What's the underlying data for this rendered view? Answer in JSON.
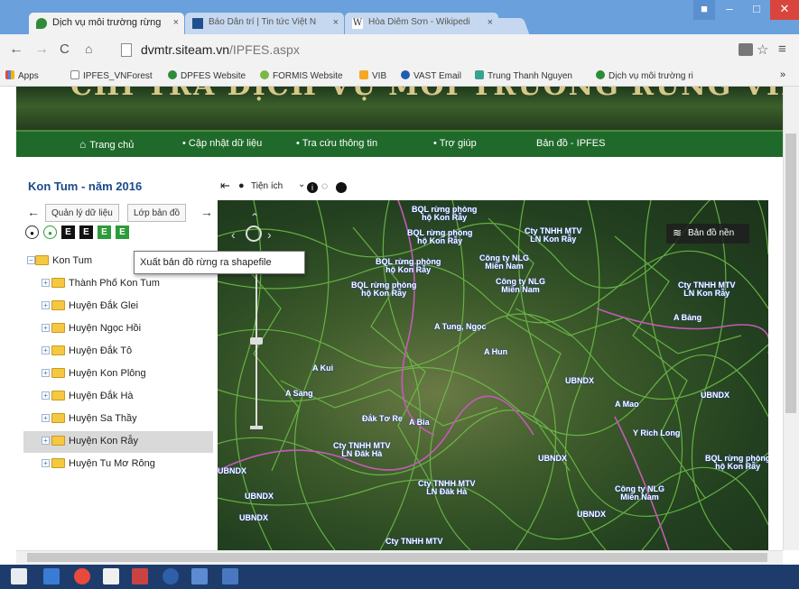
{
  "browser": {
    "tabs": [
      {
        "title": "Dịch vụ môi trường rừng",
        "close": "×"
      },
      {
        "title": "Báo Dân trí | Tin tức Việt N",
        "close": "×"
      },
      {
        "title": "Hòa Diêm Sơn - Wikipedi",
        "close": "×"
      }
    ],
    "window_controls": {
      "minimize": "–",
      "maximize": "□",
      "close": "✕"
    },
    "url_domain": "dvmtr.siteam.vn",
    "url_path": "/IPFES.aspx",
    "bookmarks": [
      "Apps",
      "IPFES_VNForest",
      "DPFES Website",
      "FORMIS Website",
      "VIB",
      "VAST Email",
      "Trung Thanh Nguyen",
      "Dịch vụ môi trường ri"
    ],
    "bookmarks_more": "»"
  },
  "site": {
    "banner_text": "CHI TRẢ DỊCH VỤ MÔI TRƯỜNG RỪNG VIỆT NAM",
    "nav": [
      "Trang chủ",
      "• Cập nhật dữ liệu",
      "• Tra cứu thông tin",
      "• Trợ giúp",
      "Bản đồ - IPFES"
    ]
  },
  "left_panel": {
    "title": "Kon Tum - năm 2016",
    "tabs": [
      "Quản lý dữ liệu",
      "Lớp bản đồ"
    ],
    "tree": {
      "root": "Kon Tum",
      "children": [
        "Thành Phố Kon Tum",
        "Huyện Đắk Glei",
        "Huyện Ngọc Hồi",
        "Huyện Đắk Tô",
        "Huyện Kon Plông",
        "Huyện Đắk Hà",
        "Huyện Sa Thầy",
        "Huyện Kon Rẫy",
        "Huyện Tu Mơ Rông"
      ],
      "selected": "Huyện Kon Rẫy"
    },
    "tooltip": "Xuất bản đồ rừng ra shapefile"
  },
  "map": {
    "toolbar_label": "Tiện ích",
    "basemap_button": "Bản đồ nền",
    "labels": [
      "BQL rừng phòng\nhộ Kon Rẫy",
      "Cty TNHH MTV\nLN Kon Rẫy",
      "BQL rừng phòng\nhộ Kon Rẫy",
      "Công ty NLG\nMiền Nam",
      "BQL rừng phòng\nhộ Kon Rẫy",
      "BQL rừng phòng\nhộ Kon Rẫy",
      "Công ty NLG\nMiền Nam",
      "Cty TNHH MTV\nLN Kon Rẫy",
      "A Bảng",
      "A Tung, Ngọc",
      "A Hun",
      "A Kui",
      "UBNDX",
      "A Sang",
      "A Mao",
      "UBNDX",
      "Y Rich Long",
      "Đắk Tơ Re",
      "A Bia",
      "Cty TNHH MTV\nLN Đăk Hà",
      "UBNDX",
      "BQL rừng phòng\nhộ Kon Rẫy",
      "UBNDX",
      "Cty TNHH MTV\nLN Đăk Hà",
      "Công ty NLG\nMiền Nam",
      "UBNDX",
      "UBNDX",
      "UBNDX",
      "Cty TNHH MTV"
    ]
  }
}
